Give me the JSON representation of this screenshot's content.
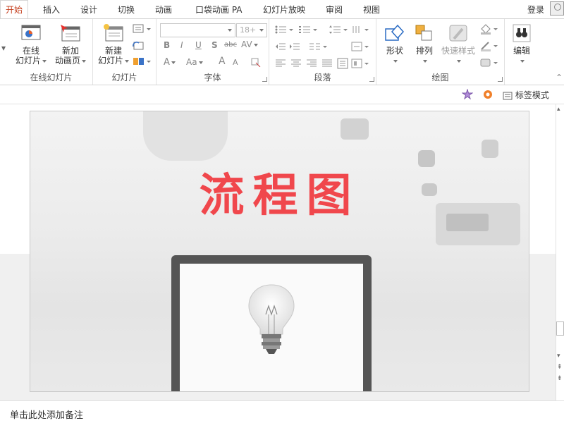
{
  "tabs": [
    "开始",
    "插入",
    "设计",
    "切换",
    "动画",
    "口袋动画 PA",
    "幻灯片放映",
    "审阅",
    "视图"
  ],
  "login": "登录",
  "ribbon": {
    "group_online": {
      "label": "在线幻灯片",
      "online_slides_line1": "在线",
      "online_slides_line2": "幻灯片",
      "new_anim_page_line1": "新加",
      "new_anim_page_line2": "动画页"
    },
    "group_slides": {
      "label": "幻灯片",
      "new_slide_line1": "新建",
      "new_slide_line2": "幻灯片"
    },
    "group_font": {
      "label": "字体",
      "font_size": "18+",
      "bold": "B",
      "italic": "I",
      "underline": "U",
      "shadow": "S",
      "strike": "abc",
      "spacing": "AV",
      "font_color": "A",
      "change_case": "Aa",
      "grow": "A",
      "shrink": "A"
    },
    "group_paragraph": {
      "label": "段落"
    },
    "group_drawing": {
      "label": "绘图",
      "shapes": "形状",
      "arrange": "排列",
      "quick_styles": "快速样式"
    },
    "group_editing": {
      "edit": "编辑"
    }
  },
  "subbar": {
    "tag_mode": "标签模式"
  },
  "slide": {
    "title": "流程图"
  },
  "notes": {
    "placeholder": "单击此处添加备注"
  },
  "colors": {
    "accent": "#c43e1c",
    "title_red": "#f0474c"
  }
}
